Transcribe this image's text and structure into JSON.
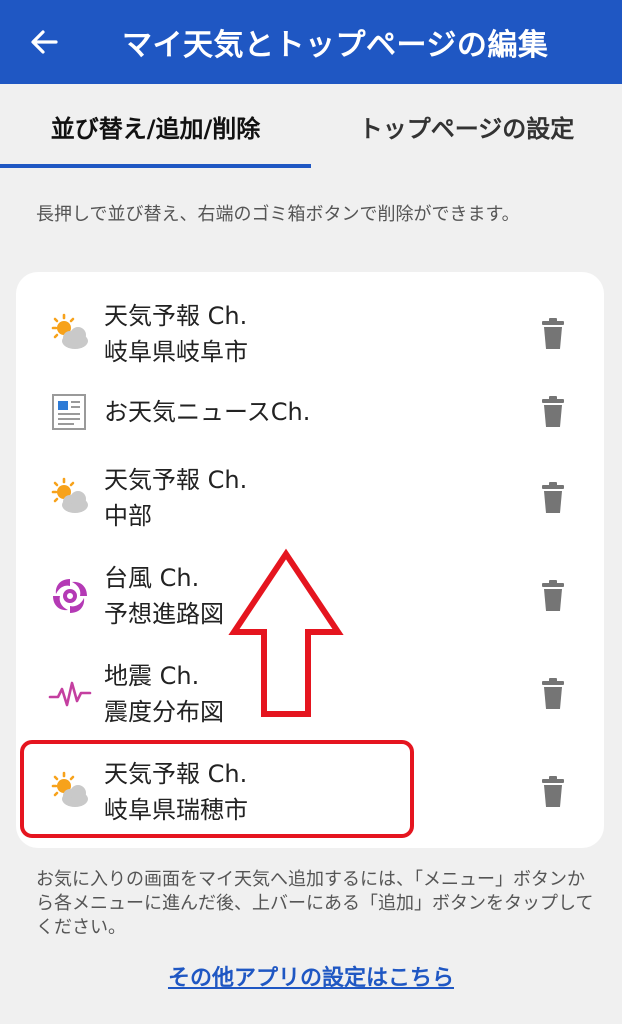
{
  "appbar": {
    "title": "マイ天気とトップページの編集",
    "back_icon": "arrow-left-icon",
    "bg_color": "#1f57c3"
  },
  "tabs": [
    {
      "label": "並び替え/追加/削除",
      "selected": true
    },
    {
      "label": "トップページの設定",
      "selected": false
    }
  ],
  "hint": "長押しで並び替え、右端のゴミ箱ボタンで削除ができます。",
  "items": [
    {
      "icon": "weather-sun-cloud-icon",
      "line1": "天気予報 Ch.",
      "line2": "岐阜県岐阜市"
    },
    {
      "icon": "newspaper-icon",
      "line1": "お天気ニュースCh.",
      "line2": ""
    },
    {
      "icon": "weather-sun-cloud-icon",
      "line1": "天気予報 Ch.",
      "line2": "中部"
    },
    {
      "icon": "typhoon-icon",
      "line1": "台風 Ch.",
      "line2": "予想進路図"
    },
    {
      "icon": "earthquake-wave-icon",
      "line1": "地震 Ch.",
      "line2": "震度分布図"
    },
    {
      "icon": "weather-sun-cloud-icon",
      "line1": "天気予報 Ch.",
      "line2": "岐阜県瑞穂市"
    }
  ],
  "trash_icon": "trash-icon",
  "footer_note": "お気に入りの画面をマイ天気へ追加するには、「メニュー」ボタンから各メニューに進んだ後、上バーにある「追加」ボタンをタップしてください。",
  "footer_link": "その他アプリの設定はこちら",
  "annotation_colors": {
    "highlight": "#e5151f"
  }
}
